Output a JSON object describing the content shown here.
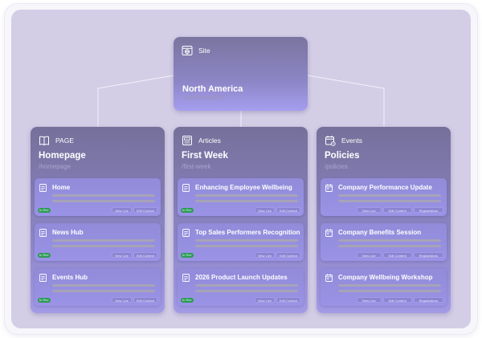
{
  "site": {
    "label": "Site",
    "title": "North America",
    "icon": "globe-window-icon"
  },
  "columns": [
    {
      "label": "PAGE",
      "icon": "book-icon",
      "title": "Homepage",
      "path": "/homepage",
      "items": [
        {
          "title": "Home",
          "badge": "In Rev",
          "buttons": [
            "View Live",
            "Edit Content"
          ]
        },
        {
          "title": "News Hub",
          "badge": "In Rev",
          "buttons": [
            "View Live",
            "Edit Content"
          ]
        },
        {
          "title": "Events Hub",
          "badge": "In Rev",
          "buttons": [
            "View Live",
            "Edit Content"
          ]
        }
      ]
    },
    {
      "label": "Articles",
      "icon": "newspaper-icon",
      "title": "First Week",
      "path": "/first-week",
      "items": [
        {
          "title": "Enhancing Employee Wellbeing",
          "badge": "In Rev",
          "buttons": [
            "View Live",
            "Edit Content"
          ]
        },
        {
          "title": "Top Sales Performers Recognition",
          "badge": "In Rev",
          "buttons": [
            "View Live",
            "Edit Content"
          ]
        },
        {
          "title": "2026 Product Launch Updates",
          "badge": "In Rev",
          "buttons": [
            "View Live",
            "Edit Content"
          ]
        }
      ]
    },
    {
      "label": "Events",
      "icon": "calendar-icon",
      "title": "Policies",
      "path": "/policies",
      "items": [
        {
          "title": "Company Performance Update",
          "buttons": [
            "View Live",
            "Edit Content",
            "Registrations"
          ]
        },
        {
          "title": "Company Benefits Session",
          "buttons": [
            "View Live",
            "Edit Content",
            "Registrations"
          ]
        },
        {
          "title": "Company Wellbeing Workshop",
          "buttons": [
            "View Live",
            "Edit Content",
            "Registrations"
          ]
        }
      ]
    }
  ]
}
